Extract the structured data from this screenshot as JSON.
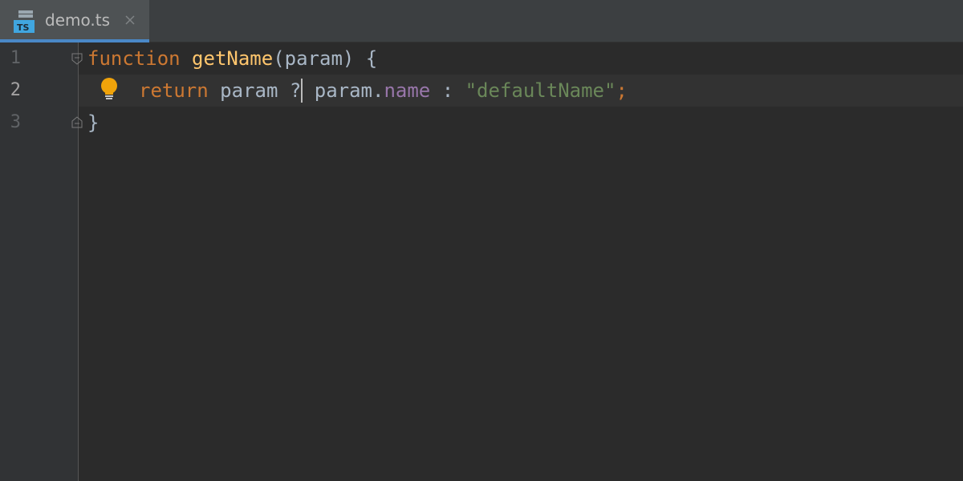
{
  "tab": {
    "icon": "typescript-file-icon",
    "icon_label": "TS",
    "title": "demo.ts"
  },
  "gutter": {
    "line_numbers": [
      "1",
      "2",
      "3"
    ],
    "current_line": 2
  },
  "code": {
    "lines": [
      {
        "tokens": [
          {
            "text": "function",
            "kind": "keyword"
          },
          {
            "text": " ",
            "kind": "plain"
          },
          {
            "text": "getName",
            "kind": "function"
          },
          {
            "text": "(param) {",
            "kind": "plain"
          }
        ]
      },
      {
        "tokens": [
          {
            "text": "return",
            "kind": "keyword"
          },
          {
            "text": " param ?",
            "kind": "plain"
          },
          {
            "text": " param.",
            "kind": "plain"
          },
          {
            "text": "name",
            "kind": "property"
          },
          {
            "text": " : ",
            "kind": "plain"
          },
          {
            "text": "\"defaultName\"",
            "kind": "string"
          },
          {
            "text": ";",
            "kind": "keyword"
          }
        ]
      },
      {
        "tokens": [
          {
            "text": "}",
            "kind": "plain"
          }
        ]
      }
    ]
  },
  "intention": {
    "icon": "lightbulb-icon"
  },
  "colors": {
    "editor_bg": "#2b2b2b",
    "gutter_bg": "#313335",
    "keyword": "#cc7832",
    "function": "#ffc66d",
    "property": "#9876aa",
    "string": "#6a8759",
    "plain": "#a9b7c6",
    "tab_accent": "#4a88c7",
    "bulb": "#f0a30a"
  }
}
